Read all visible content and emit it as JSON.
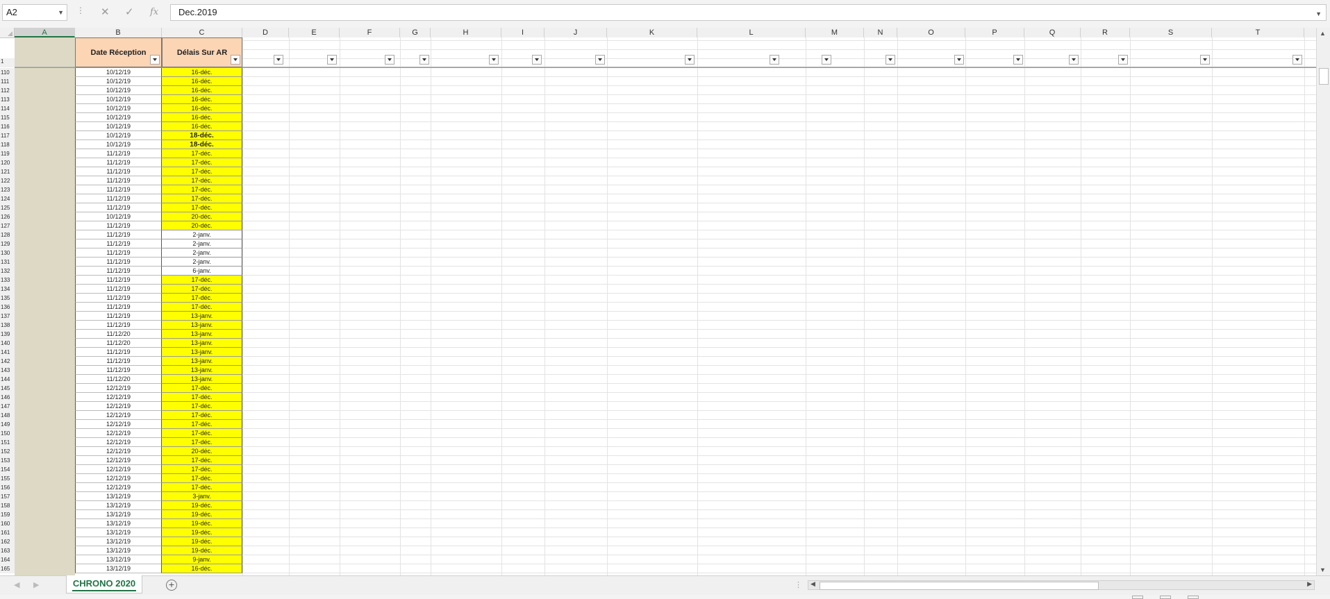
{
  "formula_bar": {
    "name_box": "A2",
    "cancel_icon": "✕",
    "enter_icon": "✓",
    "function_icon": "fx",
    "formula": "Dec.2019"
  },
  "columns": [
    "A",
    "B",
    "C",
    "D",
    "E",
    "F",
    "G",
    "H",
    "I",
    "J",
    "K",
    "L",
    "M",
    "N",
    "O",
    "P",
    "Q",
    "R",
    "S",
    "T"
  ],
  "header_row": {
    "row_number": "1",
    "date_reception": "Date Réception",
    "delais_sur_ar": "Délais Sur AR"
  },
  "rows": [
    {
      "n": "110",
      "b": "10/12/19",
      "c": "16-déc.",
      "fill": "yellow"
    },
    {
      "n": "111",
      "b": "10/12/19",
      "c": "16-déc.",
      "fill": "yellow"
    },
    {
      "n": "112",
      "b": "10/12/19",
      "c": "16-déc.",
      "fill": "yellow"
    },
    {
      "n": "113",
      "b": "10/12/19",
      "c": "16-déc.",
      "fill": "yellow"
    },
    {
      "n": "114",
      "b": "10/12/19",
      "c": "16-déc.",
      "fill": "yellow"
    },
    {
      "n": "115",
      "b": "10/12/19",
      "c": "16-déc.",
      "fill": "yellow"
    },
    {
      "n": "116",
      "b": "10/12/19",
      "c": "16-déc.",
      "fill": "yellow"
    },
    {
      "n": "117",
      "b": "10/12/19",
      "c": "18-déc.",
      "fill": "yellow",
      "bold": true
    },
    {
      "n": "118",
      "b": "10/12/19",
      "c": "18-déc.",
      "fill": "yellow",
      "bold": true
    },
    {
      "n": "119",
      "b": "11/12/19",
      "c": "17-déc.",
      "fill": "yellow"
    },
    {
      "n": "120",
      "b": "11/12/19",
      "c": "17-déc.",
      "fill": "yellow"
    },
    {
      "n": "121",
      "b": "11/12/19",
      "c": "17-déc.",
      "fill": "yellow"
    },
    {
      "n": "122",
      "b": "11/12/19",
      "c": "17-déc.",
      "fill": "yellow"
    },
    {
      "n": "123",
      "b": "11/12/19",
      "c": "17-déc.",
      "fill": "yellow"
    },
    {
      "n": "124",
      "b": "11/12/19",
      "c": "17-déc.",
      "fill": "yellow"
    },
    {
      "n": "125",
      "b": "11/12/19",
      "c": "17-déc.",
      "fill": "yellow"
    },
    {
      "n": "126",
      "b": "10/12/19",
      "c": "20-déc.",
      "fill": "yellow"
    },
    {
      "n": "127",
      "b": "11/12/19",
      "c": "20-déc.",
      "fill": "yellow"
    },
    {
      "n": "128",
      "b": "11/12/19",
      "c": "2-janv.",
      "fill": "white"
    },
    {
      "n": "129",
      "b": "11/12/19",
      "c": "2-janv.",
      "fill": "white"
    },
    {
      "n": "130",
      "b": "11/12/19",
      "c": "2-janv.",
      "fill": "white"
    },
    {
      "n": "131",
      "b": "11/12/19",
      "c": "2-janv.",
      "fill": "white"
    },
    {
      "n": "132",
      "b": "11/12/19",
      "c": "6-janv.",
      "fill": "white"
    },
    {
      "n": "133",
      "b": "11/12/19",
      "c": "17-déc.",
      "fill": "yellow"
    },
    {
      "n": "134",
      "b": "11/12/19",
      "c": "17-déc.",
      "fill": "yellow"
    },
    {
      "n": "135",
      "b": "11/12/19",
      "c": "17-déc.",
      "fill": "yellow"
    },
    {
      "n": "136",
      "b": "11/12/19",
      "c": "17-déc.",
      "fill": "yellow"
    },
    {
      "n": "137",
      "b": "11/12/19",
      "c": "13-janv.",
      "fill": "yellow"
    },
    {
      "n": "138",
      "b": "11/12/19",
      "c": "13-janv.",
      "fill": "yellow"
    },
    {
      "n": "139",
      "b": "11/12/20",
      "c": "13-janv.",
      "fill": "yellow"
    },
    {
      "n": "140",
      "b": "11/12/20",
      "c": "13-janv.",
      "fill": "yellow"
    },
    {
      "n": "141",
      "b": "11/12/19",
      "c": "13-janv.",
      "fill": "yellow"
    },
    {
      "n": "142",
      "b": "11/12/19",
      "c": "13-janv.",
      "fill": "yellow"
    },
    {
      "n": "143",
      "b": "11/12/19",
      "c": "13-janv.",
      "fill": "yellow"
    },
    {
      "n": "144",
      "b": "11/12/20",
      "c": "13-janv.",
      "fill": "yellow"
    },
    {
      "n": "145",
      "b": "12/12/19",
      "c": "17-déc.",
      "fill": "yellow"
    },
    {
      "n": "146",
      "b": "12/12/19",
      "c": "17-déc.",
      "fill": "yellow"
    },
    {
      "n": "147",
      "b": "12/12/19",
      "c": "17-déc.",
      "fill": "yellow"
    },
    {
      "n": "148",
      "b": "12/12/19",
      "c": "17-déc.",
      "fill": "yellow"
    },
    {
      "n": "149",
      "b": "12/12/19",
      "c": "17-déc.",
      "fill": "yellow"
    },
    {
      "n": "150",
      "b": "12/12/19",
      "c": "17-déc.",
      "fill": "yellow"
    },
    {
      "n": "151",
      "b": "12/12/19",
      "c": "17-déc.",
      "fill": "yellow"
    },
    {
      "n": "152",
      "b": "12/12/19",
      "c": "20-déc.",
      "fill": "yellow"
    },
    {
      "n": "153",
      "b": "12/12/19",
      "c": "17-déc.",
      "fill": "yellow"
    },
    {
      "n": "154",
      "b": "12/12/19",
      "c": "17-déc.",
      "fill": "yellow"
    },
    {
      "n": "155",
      "b": "12/12/19",
      "c": "17-déc.",
      "fill": "yellow"
    },
    {
      "n": "156",
      "b": "12/12/19",
      "c": "17-déc.",
      "fill": "yellow"
    },
    {
      "n": "157",
      "b": "13/12/19",
      "c": "3-janv.",
      "fill": "yellow"
    },
    {
      "n": "158",
      "b": "13/12/19",
      "c": "19-déc.",
      "fill": "yellow"
    },
    {
      "n": "159",
      "b": "13/12/19",
      "c": "19-déc.",
      "fill": "yellow"
    },
    {
      "n": "160",
      "b": "13/12/19",
      "c": "19-déc.",
      "fill": "yellow"
    },
    {
      "n": "161",
      "b": "13/12/19",
      "c": "19-déc.",
      "fill": "yellow"
    },
    {
      "n": "162",
      "b": "13/12/19",
      "c": "19-déc.",
      "fill": "yellow"
    },
    {
      "n": "163",
      "b": "13/12/19",
      "c": "19-déc.",
      "fill": "yellow"
    },
    {
      "n": "164",
      "b": "13/12/19",
      "c": "9-janv.",
      "fill": "yellow"
    },
    {
      "n": "165",
      "b": "13/12/19",
      "c": "16-déc.",
      "fill": "yellow"
    }
  ],
  "sheet_tabs": [
    {
      "label": "CHRONO 2020",
      "active": true
    }
  ],
  "colors": {
    "accent_green": "#217346",
    "header_peach": "#fcd5b4",
    "highlight_yellow": "#ffff00",
    "column_a_fill": "#ddd9c4"
  },
  "icons": {
    "name_box_dropdown": "chevron-down-icon",
    "add_sheet": "plus-circle-icon",
    "filter": "filter-dropdown-icon"
  }
}
